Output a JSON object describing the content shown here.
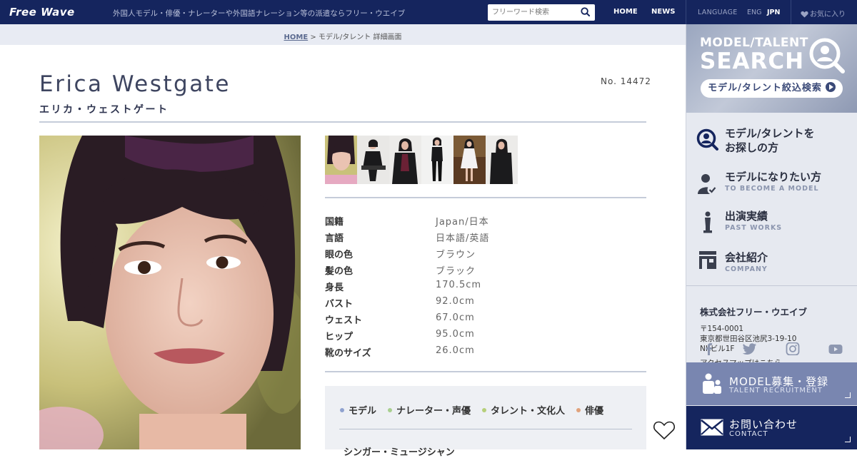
{
  "header": {
    "logo": "Free Wave",
    "tagline": "外国人モデル・俳優・ナレーターや外国語ナレーション等の派遣ならフリー・ウエイブ",
    "search_placeholder": "フリーワード検索",
    "nav": {
      "home": "HOME",
      "news": "NEWS"
    },
    "language_label": "LANGUAGE",
    "lang_eng": "ENG",
    "lang_jpn": "JPN",
    "favorites": "お気に入り"
  },
  "breadcrumb": {
    "home": "HOME",
    "separator": ">",
    "current": "モデル/タレント 詳細画面"
  },
  "profile": {
    "name_en": "Erica Westgate",
    "name_ja": "エリカ・ウェストゲート",
    "number": "No. 14472",
    "specs": [
      {
        "label": "国籍",
        "value": "Japan/日本"
      },
      {
        "label": "言語",
        "value": "日本語/英語"
      },
      {
        "label": "眼の色",
        "value": "ブラウン"
      },
      {
        "label": "髪の色",
        "value": "ブラック"
      },
      {
        "label": "身長",
        "value": "170.5cm"
      },
      {
        "label": "バスト",
        "value": "92.0cm"
      },
      {
        "label": "ウェスト",
        "value": "67.0cm"
      },
      {
        "label": "ヒップ",
        "value": "95.0cm"
      },
      {
        "label": "靴のサイズ",
        "value": "26.0cm"
      }
    ],
    "categories": [
      {
        "label": "モデル",
        "color": "#8fa2cf"
      },
      {
        "label": "ナレーター・声優",
        "color": "#a8cf8f"
      },
      {
        "label": "タレント・文化人",
        "color": "#b6cf7a"
      },
      {
        "label": "俳優",
        "color": "#e0a27c"
      }
    ],
    "category_row2": "シンガー・ミュージシャン"
  },
  "sidebar": {
    "banner_line1": "MODEL/TALENT",
    "banner_line2": "SEARCH",
    "banner_button": "モデル/タレント絞込検索",
    "menu": [
      {
        "title_line1": "モデル/タレントを",
        "title_line2": "お探しの方",
        "sub": ""
      },
      {
        "title_line1": "モデルになりたい方",
        "title_line2": "",
        "sub": "TO BECOME A MODEL"
      },
      {
        "title_line1": "出演実績",
        "title_line2": "",
        "sub": "PAST WORKS"
      },
      {
        "title_line1": "会社紹介",
        "title_line2": "",
        "sub": "COMPANY"
      }
    ],
    "company": {
      "name": "株式会社フリー・ウエイブ",
      "postal": "〒154-0001",
      "address1": "東京都世田谷区池尻3-19-10",
      "address2": "NKビル1F",
      "access": "アクセスマップはこちら"
    },
    "recruit": {
      "title": "MODEL募集・登録",
      "sub": "TALENT RECRUITMENT"
    },
    "contact": {
      "title": "お問い合わせ",
      "sub": "CONTACT"
    }
  },
  "colors": {
    "navy": "#15255e",
    "accent": "#7986b0",
    "sidebar_bg": "#e6e9f0"
  }
}
